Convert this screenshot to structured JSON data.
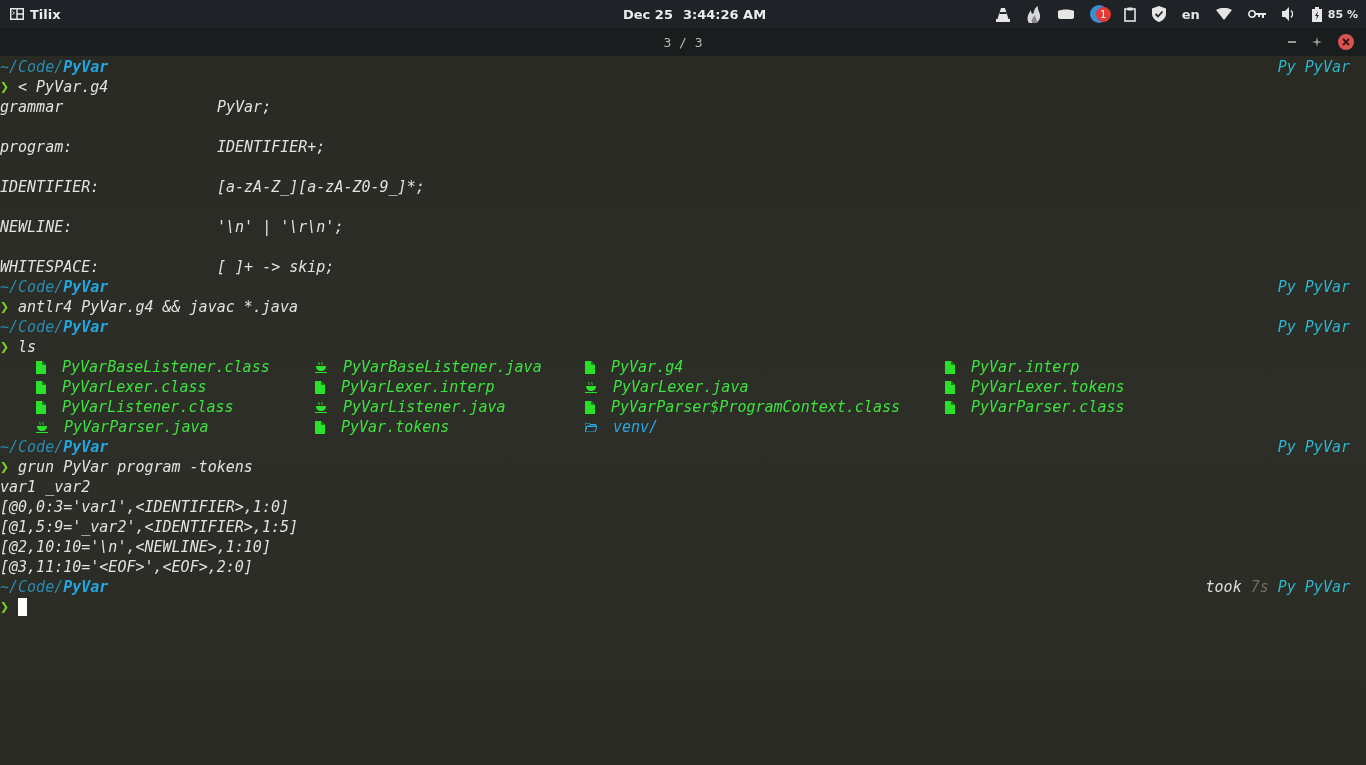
{
  "top_panel": {
    "app": "Tilix",
    "date": "Dec 25",
    "time": "3:44:26 AM",
    "notification_count": "1",
    "keyboard_layout": "en",
    "battery": "85 %"
  },
  "title_bar": {
    "title": "3 / 3"
  },
  "terminal": {
    "lines": [
      {
        "kind": "path",
        "path": "~/Code/",
        "dir": "PyVar",
        "right": [
          {
            "kind": "accent",
            "text": "Py PyVar"
          }
        ]
      },
      {
        "kind": "command",
        "symbol": "❯",
        "text": "< PyVar.g4"
      },
      {
        "kind": "pair",
        "left": "grammar",
        "right": "PyVar;"
      },
      {
        "kind": "blank"
      },
      {
        "kind": "pair",
        "left": "program:",
        "right": "IDENTIFIER+;"
      },
      {
        "kind": "blank"
      },
      {
        "kind": "pair",
        "left": "IDENTIFIER:",
        "right": "[a-zA-Z_][a-zA-Z0-9_]*;"
      },
      {
        "kind": "blank"
      },
      {
        "kind": "pair",
        "left": "NEWLINE:",
        "right": "'\\n' | '\\r\\n';"
      },
      {
        "kind": "blank"
      },
      {
        "kind": "pair",
        "left": "WHITESPACE:",
        "right": "[ ]+ -> skip;"
      },
      {
        "kind": "path",
        "path": "~/Code/",
        "dir": "PyVar",
        "right": [
          {
            "kind": "accent",
            "text": "Py PyVar"
          }
        ]
      },
      {
        "kind": "command",
        "symbol": "❯",
        "text": "antlr4 PyVar.g4 && javac *.java"
      },
      {
        "kind": "path",
        "path": "~/Code/",
        "dir": "PyVar",
        "right": [
          {
            "kind": "accent",
            "text": "Py PyVar"
          }
        ]
      },
      {
        "kind": "command",
        "symbol": "❯",
        "text": "ls"
      },
      {
        "kind": "files",
        "entries": [
          {
            "kind": "file",
            "name": "PyVarBaseListener.class"
          },
          {
            "kind": "java",
            "name": "PyVarBaseListener.java"
          },
          {
            "kind": "file",
            "name": "PyVar.g4"
          },
          {
            "kind": "file",
            "name": "PyVar.interp"
          },
          {
            "kind": "file",
            "name": "PyVarLexer.class"
          },
          {
            "kind": "file",
            "name": "PyVarLexer.interp"
          },
          {
            "kind": "java",
            "name": "PyVarLexer.java"
          },
          {
            "kind": "file",
            "name": "PyVarLexer.tokens"
          },
          {
            "kind": "file",
            "name": "PyVarListener.class"
          },
          {
            "kind": "java",
            "name": "PyVarListener.java"
          },
          {
            "kind": "file",
            "name": "PyVarParser$ProgramContext.class"
          },
          {
            "kind": "file",
            "name": "PyVarParser.class"
          },
          {
            "kind": "java",
            "name": "PyVarParser.java"
          },
          {
            "kind": "file",
            "name": "PyVar.tokens"
          },
          {
            "kind": "folder",
            "name": "venv/"
          }
        ]
      },
      {
        "kind": "path",
        "path": "~/Code/",
        "dir": "PyVar",
        "right": [
          {
            "kind": "accent",
            "text": "Py PyVar"
          }
        ]
      },
      {
        "kind": "command",
        "symbol": "❯",
        "text": "grun PyVar program -tokens"
      },
      {
        "kind": "output",
        "text": "var1 _var2"
      },
      {
        "kind": "output",
        "text": "[@0,0:3='var1',<IDENTIFIER>,1:0]"
      },
      {
        "kind": "output",
        "text": "[@1,5:9='_var2',<IDENTIFIER>,1:5]"
      },
      {
        "kind": "output",
        "text": "[@2,10:10='\\n',<NEWLINE>,1:10]"
      },
      {
        "kind": "output",
        "text": "[@3,11:10='<EOF>',<EOF>,2:0]"
      },
      {
        "kind": "path",
        "path": "~/Code/",
        "dir": "PyVar",
        "right": [
          {
            "kind": "plain",
            "text": "took"
          },
          {
            "kind": "dim",
            "text": "7s"
          },
          {
            "kind": "accent",
            "text": "Py PyVar"
          }
        ]
      },
      {
        "kind": "input",
        "symbol": "❯"
      }
    ]
  }
}
